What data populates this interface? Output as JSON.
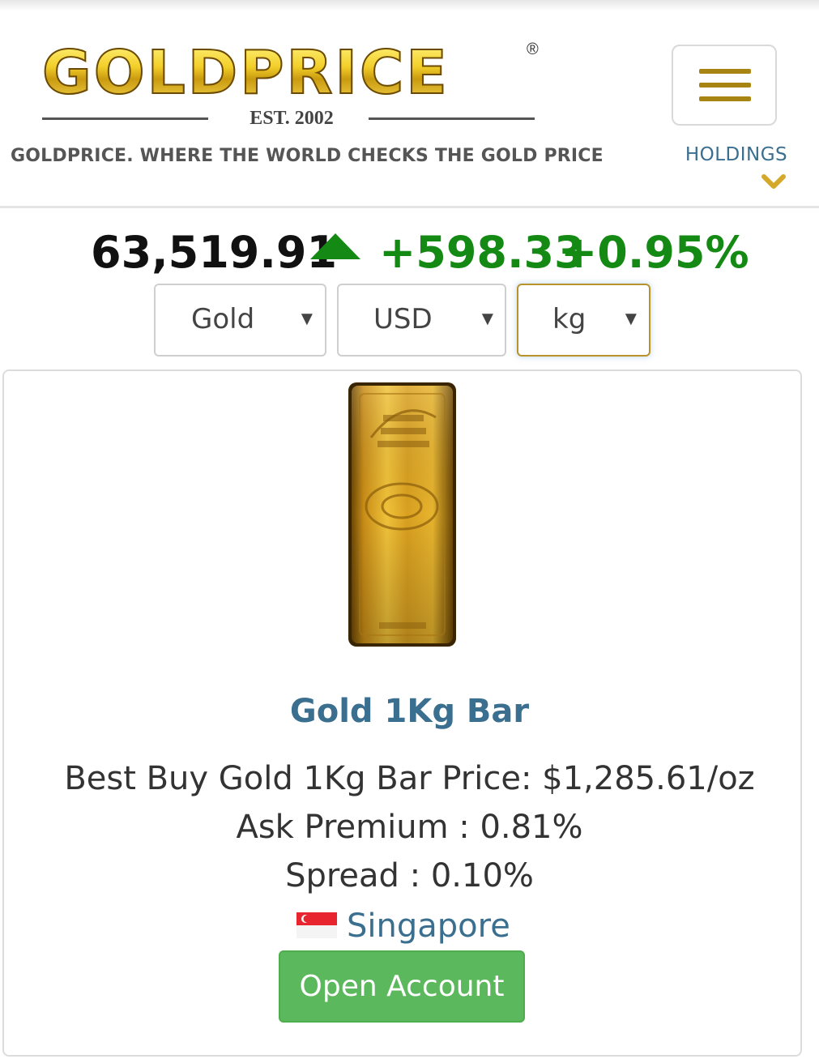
{
  "header": {
    "logo_text": "GOLDPRICE",
    "logo_registered": "®",
    "logo_established": "EST. 2002",
    "tagline": "GOLDPRICE.  WHERE THE WORLD CHECKS THE GOLD PRICE",
    "menu_icon": "hamburger-menu-icon",
    "holdings_label": "HOLDINGS",
    "holdings_icon": "chevron-down-icon"
  },
  "price": {
    "value": "63,519.91",
    "direction_icon": "up-arrow-icon",
    "change": "+598.33",
    "percent": "+0.95%"
  },
  "selectors": {
    "metal": "Gold",
    "currency": "USD",
    "unit": "kg"
  },
  "product": {
    "image": "gold-bar-image",
    "title": "Gold 1Kg Bar",
    "best_buy": "Best Buy Gold 1Kg Bar Price: $1,285.61/oz",
    "ask_premium": "Ask Premium : 0.81%",
    "spread": "Spread : 0.10%",
    "location_flag": "singapore-flag-icon",
    "location": "Singapore",
    "cta": "Open Account"
  },
  "colors": {
    "gold_accent": "#a88412",
    "link_blue": "#3b6f8f",
    "up_green": "#148a14",
    "button_green": "#5cb85c"
  }
}
